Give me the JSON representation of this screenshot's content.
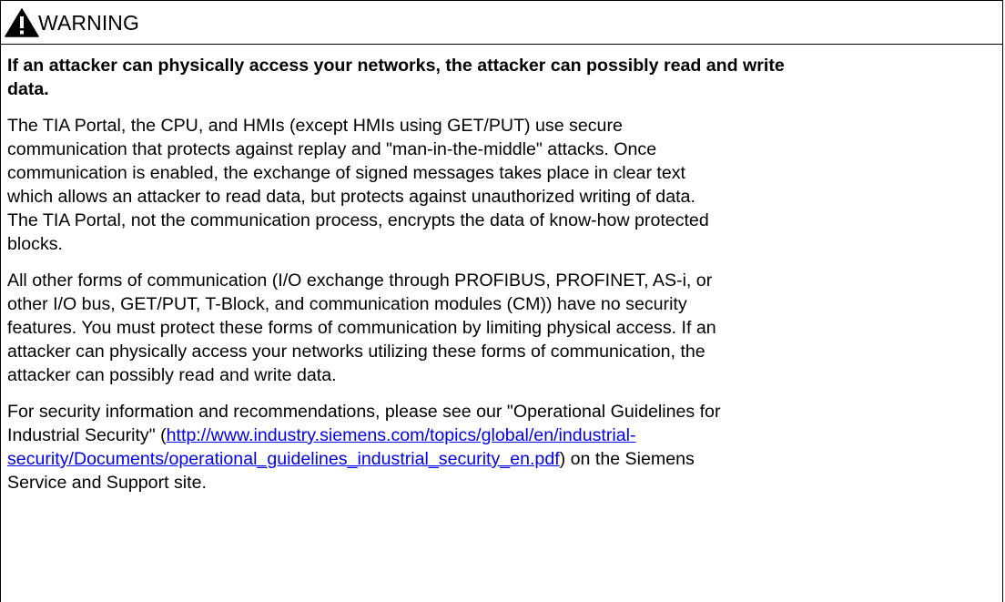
{
  "notice": {
    "title": "WARNING",
    "icon": "warning-triangle-icon",
    "accent_color": "#000000",
    "link_color": "#0000ee",
    "lines_bold": [
      "If an attacker can physically access your networks, the attacker can possibly read and write",
      "data."
    ],
    "para1_lines": [
      "The TIA Portal, the CPU, and HMIs (except HMIs using GET/PUT) use secure",
      "communication that protects against replay and \"man-in-the-middle\" attacks. Once",
      "communication is enabled, the exchange of signed messages takes place in clear text",
      "which allows an attacker to read data, but protects against unauthorized writing of data.",
      "The TIA Portal, not the communication process, encrypts the data of know-how protected",
      "blocks."
    ],
    "para2_lines": [
      "All other forms of communication (I/O exchange through PROFIBUS, PROFINET, AS-i, or",
      "other I/O bus, GET/PUT, T-Block, and communication modules (CM)) have no security",
      "features. You must protect these forms of communication by limiting physical access. If an",
      "attacker can physically access your networks utilizing these forms of communication, the",
      "attacker can possibly read and write data."
    ],
    "para3": {
      "line1": "For security information and recommendations, please see our \"Operational Guidelines for",
      "line2_prefix": "Industrial Security\" (",
      "link_part1": "http://www.industry.siemens.com/topics/global/en/industrial-",
      "link_part2": "security/Documents/operational_guidelines_industrial_security_en.pdf",
      "line3_suffix": ") on the Siemens",
      "line4": "Service and Support site."
    }
  }
}
